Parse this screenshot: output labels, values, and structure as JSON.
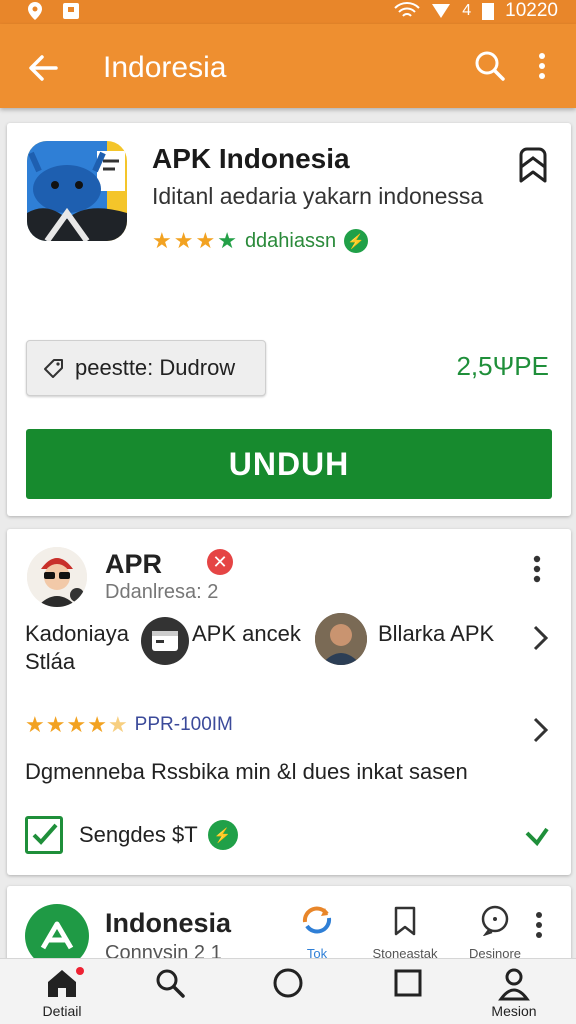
{
  "status_bar": {
    "time": "10220",
    "battery_text": "4"
  },
  "app_bar": {
    "title": "Indoresia"
  },
  "app_card": {
    "title": "APK Indonesia",
    "subtitle": "Iditanl aedaria yakarn indonessa",
    "rating_text": "ddahiassn",
    "chip_label": "peestte: Dudrow",
    "price": "2,5ΨPE",
    "download_label": "UNDUH"
  },
  "review_card": {
    "title": "APR",
    "subtitle": "Ddanlresa: 2",
    "row1_text1": "Kadoniaya",
    "row1_text1b": "Stláa",
    "row1_text2": "APK ancek",
    "row1_text3": "Bllarka APK",
    "rating_text": "PPR-100IM",
    "description": "Dgmenneba   Rssbika min  &l dues inkat sasen",
    "check_label": "Sengdes $T"
  },
  "third_card": {
    "title": "Indonesia",
    "subtitle": "Connysin  2  1",
    "tools": [
      {
        "label": "Tok"
      },
      {
        "label": "Stoneastak"
      },
      {
        "label": "Desinore"
      }
    ]
  },
  "bottom_nav": {
    "items": [
      {
        "label": "Detiail"
      },
      {
        "label": ""
      },
      {
        "label": ""
      },
      {
        "label": ""
      },
      {
        "label": "Mesion"
      }
    ]
  },
  "colors": {
    "appbar": "#ee8f30",
    "download": "#178a2e",
    "price": "#1f8f3a"
  }
}
